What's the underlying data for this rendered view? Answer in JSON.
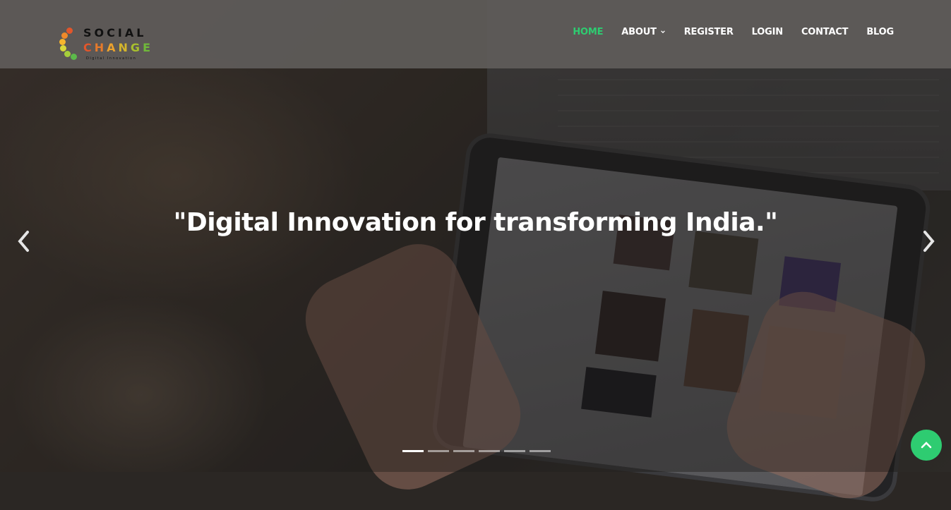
{
  "logo": {
    "word1": "SOCIAL",
    "word2_letters": [
      "C",
      "H",
      "A",
      "N",
      "G",
      "E"
    ],
    "tagline": "Digital Innovation",
    "dot_colors": [
      "#e2562b",
      "#f08a2a",
      "#f6b52d",
      "#d8d83a",
      "#a6cf3b",
      "#5cb94a"
    ]
  },
  "nav": {
    "items": [
      {
        "label": "HOME",
        "active": true
      },
      {
        "label": "ABOUT",
        "has_dropdown": true
      },
      {
        "label": "REGISTER"
      },
      {
        "label": "LOGIN"
      },
      {
        "label": "CONTACT"
      },
      {
        "label": "BLOG"
      }
    ]
  },
  "hero": {
    "caption": "\"Digital Innovation for transforming India.\"",
    "slide_count": 6,
    "active_slide": 1
  },
  "colors": {
    "accent": "#2ecc71",
    "header_bg": "#5f5c5a",
    "text_light": "#ffffff"
  },
  "icons": {
    "prev": "chevron-left-icon",
    "next": "chevron-right-icon",
    "dropdown": "chevron-down-icon",
    "back_to_top": "chevron-up-icon"
  }
}
